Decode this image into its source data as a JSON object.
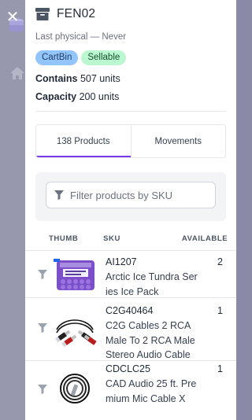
{
  "close_label": "✕",
  "bin": {
    "title": "FEN02",
    "last_physical": "Last physical — Never",
    "badges": [
      "CartBin",
      "Sellable"
    ],
    "contains_label": "Contains",
    "contains_value": "507 units",
    "capacity_label": "Capacity",
    "capacity_value": "200 units"
  },
  "tabs": [
    {
      "label": "138 Products",
      "active": true
    },
    {
      "label": "Movements",
      "active": false
    }
  ],
  "filter": {
    "placeholder": "Filter products by SKU",
    "value": ""
  },
  "table": {
    "columns": [
      "THUMB",
      "SKU",
      "AVAILABLE"
    ],
    "rows": [
      {
        "sku": "AI1207",
        "name": "Arctic Ice Tundra Series Ice Pack",
        "available": "2",
        "thumb": "ice-pack-image"
      },
      {
        "sku": "C2G40464",
        "name": "C2G Cables 2 RCA Male To 2 RCA Male Stereo Audio Cable",
        "available": "1",
        "thumb": "rca-cable-image"
      },
      {
        "sku": "CDCLC25",
        "name": "CAD Audio 25 ft. Premium Mic Cable X",
        "available": "1",
        "thumb": "mic-cable-image"
      }
    ]
  },
  "colors": {
    "accent": "#7c3aed",
    "badge_blue": "#93c5fd",
    "badge_green": "#bbf7d0"
  }
}
